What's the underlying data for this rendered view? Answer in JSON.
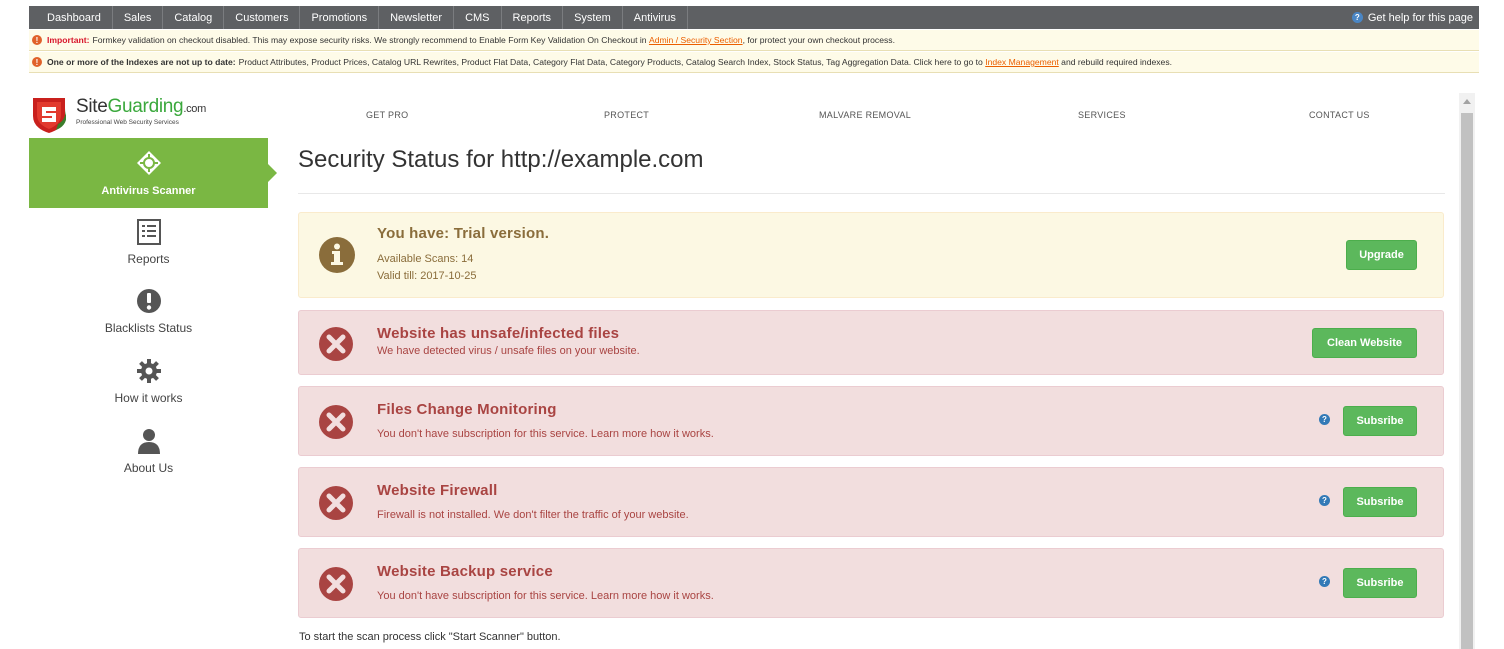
{
  "topbar": {
    "menu": [
      "Dashboard",
      "Sales",
      "Catalog",
      "Customers",
      "Promotions",
      "Newsletter",
      "CMS",
      "Reports",
      "System",
      "Antivirus"
    ],
    "help_icon": "question-circle-icon",
    "help": "Get help for this page"
  },
  "notices": {
    "n1": {
      "icon": "warning-icon",
      "strong": "Important:",
      "text": "Formkey validation on checkout disabled. This may expose security risks. We strongly recommend to Enable Form Key Validation On Checkout in",
      "link": "Admin / Security Section",
      "after": ", for protect your own checkout process."
    },
    "n2": {
      "icon": "warning-icon",
      "strong": "One or more of the Indexes are not up to date:",
      "text": "Product Attributes, Product Prices, Catalog URL Rewrites, Product Flat Data, Category Flat Data, Category Products, Catalog Search Index, Stock Status, Tag Aggregation Data. Click here to go to",
      "link": "Index Management",
      "after": "and rebuild required indexes."
    }
  },
  "logo": {
    "name_a": "Site",
    "name_b": "Guarding",
    "name_c": ".com",
    "tagline": "Professional Web Security Services"
  },
  "nav": [
    "GET PRO",
    "PROTECT",
    "MALVARE REMOVAL",
    "SERVICES",
    "CONTACT US"
  ],
  "sidebar": {
    "active": {
      "label": "Antivirus Scanner",
      "icon": "crosshair-icon"
    },
    "items": [
      {
        "label": "Reports",
        "icon": "report-list-icon"
      },
      {
        "label": "Blacklists Status",
        "icon": "exclamation-circle-icon"
      },
      {
        "label": "How it works",
        "icon": "gear-icon"
      },
      {
        "label": "About Us",
        "icon": "user-icon"
      }
    ]
  },
  "main": {
    "title": "Security Status for http://example.com",
    "trial": {
      "title": "You have: Trial version.",
      "scans": "Available Scans: 14",
      "valid": "Valid till: 2017-10-25",
      "button": "Upgrade",
      "icon": "info-circle-icon"
    },
    "alerts": [
      {
        "title": "Website has unsafe/infected files",
        "text": "We have detected virus / unsafe files on your website.",
        "button": "Clean Website",
        "icon": "error-circle-icon"
      },
      {
        "title": "Files Change Monitoring",
        "text": "You don't have subscription for this service. Learn more how it works.",
        "button": "Subsribe",
        "icon": "error-circle-icon"
      },
      {
        "title": "Website Firewall",
        "text": "Firewall is not installed. We don't filter the traffic of your website.",
        "button": "Subsribe",
        "icon": "error-circle-icon"
      },
      {
        "title": "Website Backup service",
        "text": "You don't have subscription for this service. Learn more how it works.",
        "button": "Subsribe",
        "icon": "error-circle-icon"
      }
    ],
    "bottom_note": "To start the scan process click \"Start Scanner\" button."
  },
  "colors": {
    "topbar": "#5e6063",
    "active_green": "#7ab743",
    "button_green": "#5cb85c",
    "warning_bg": "#fcf8e3",
    "error_bg": "#f2dede",
    "error_text": "#a94442",
    "warning_text": "#8a6d3b",
    "notice_link": "#eb5e00"
  }
}
